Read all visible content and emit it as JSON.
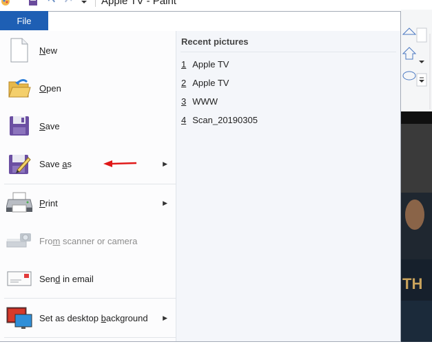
{
  "window": {
    "title": "Apple TV - Paint"
  },
  "file_tab": {
    "label": "File"
  },
  "menu": {
    "items": [
      {
        "label": "New",
        "underline_index": 0,
        "icon": "new-document-icon",
        "has_submenu": false,
        "enabled": true
      },
      {
        "label": "Open",
        "underline_index": 0,
        "icon": "open-folder-icon",
        "has_submenu": false,
        "enabled": true
      },
      {
        "label": "Save",
        "underline_index": 0,
        "icon": "save-icon",
        "has_submenu": false,
        "enabled": true
      },
      {
        "label": "Save as",
        "underline_index": 5,
        "icon": "save-as-icon",
        "has_submenu": true,
        "enabled": true
      },
      {
        "label": "Print",
        "underline_index": 0,
        "icon": "printer-icon",
        "has_submenu": true,
        "enabled": true
      },
      {
        "label": "From scanner or camera",
        "underline_index": 3,
        "icon": "scanner-icon",
        "has_submenu": false,
        "enabled": false
      },
      {
        "label": "Send in email",
        "underline_index": 3,
        "icon": "email-icon",
        "has_submenu": false,
        "enabled": true
      },
      {
        "label": "Set as desktop background",
        "underline_index": 15,
        "icon": "desktop-background-icon",
        "has_submenu": true,
        "enabled": true
      }
    ]
  },
  "recent": {
    "heading": "Recent pictures",
    "items": [
      {
        "num": "1",
        "name": "Apple TV"
      },
      {
        "num": "2",
        "name": "Apple TV"
      },
      {
        "num": "3",
        "name": "WWW"
      },
      {
        "num": "4",
        "name": "Scan_20190305"
      }
    ]
  },
  "annotation": {
    "color": "#e01818",
    "icon": "red-arrow-icon"
  },
  "colors": {
    "file_tab": "#1e5fb4"
  }
}
